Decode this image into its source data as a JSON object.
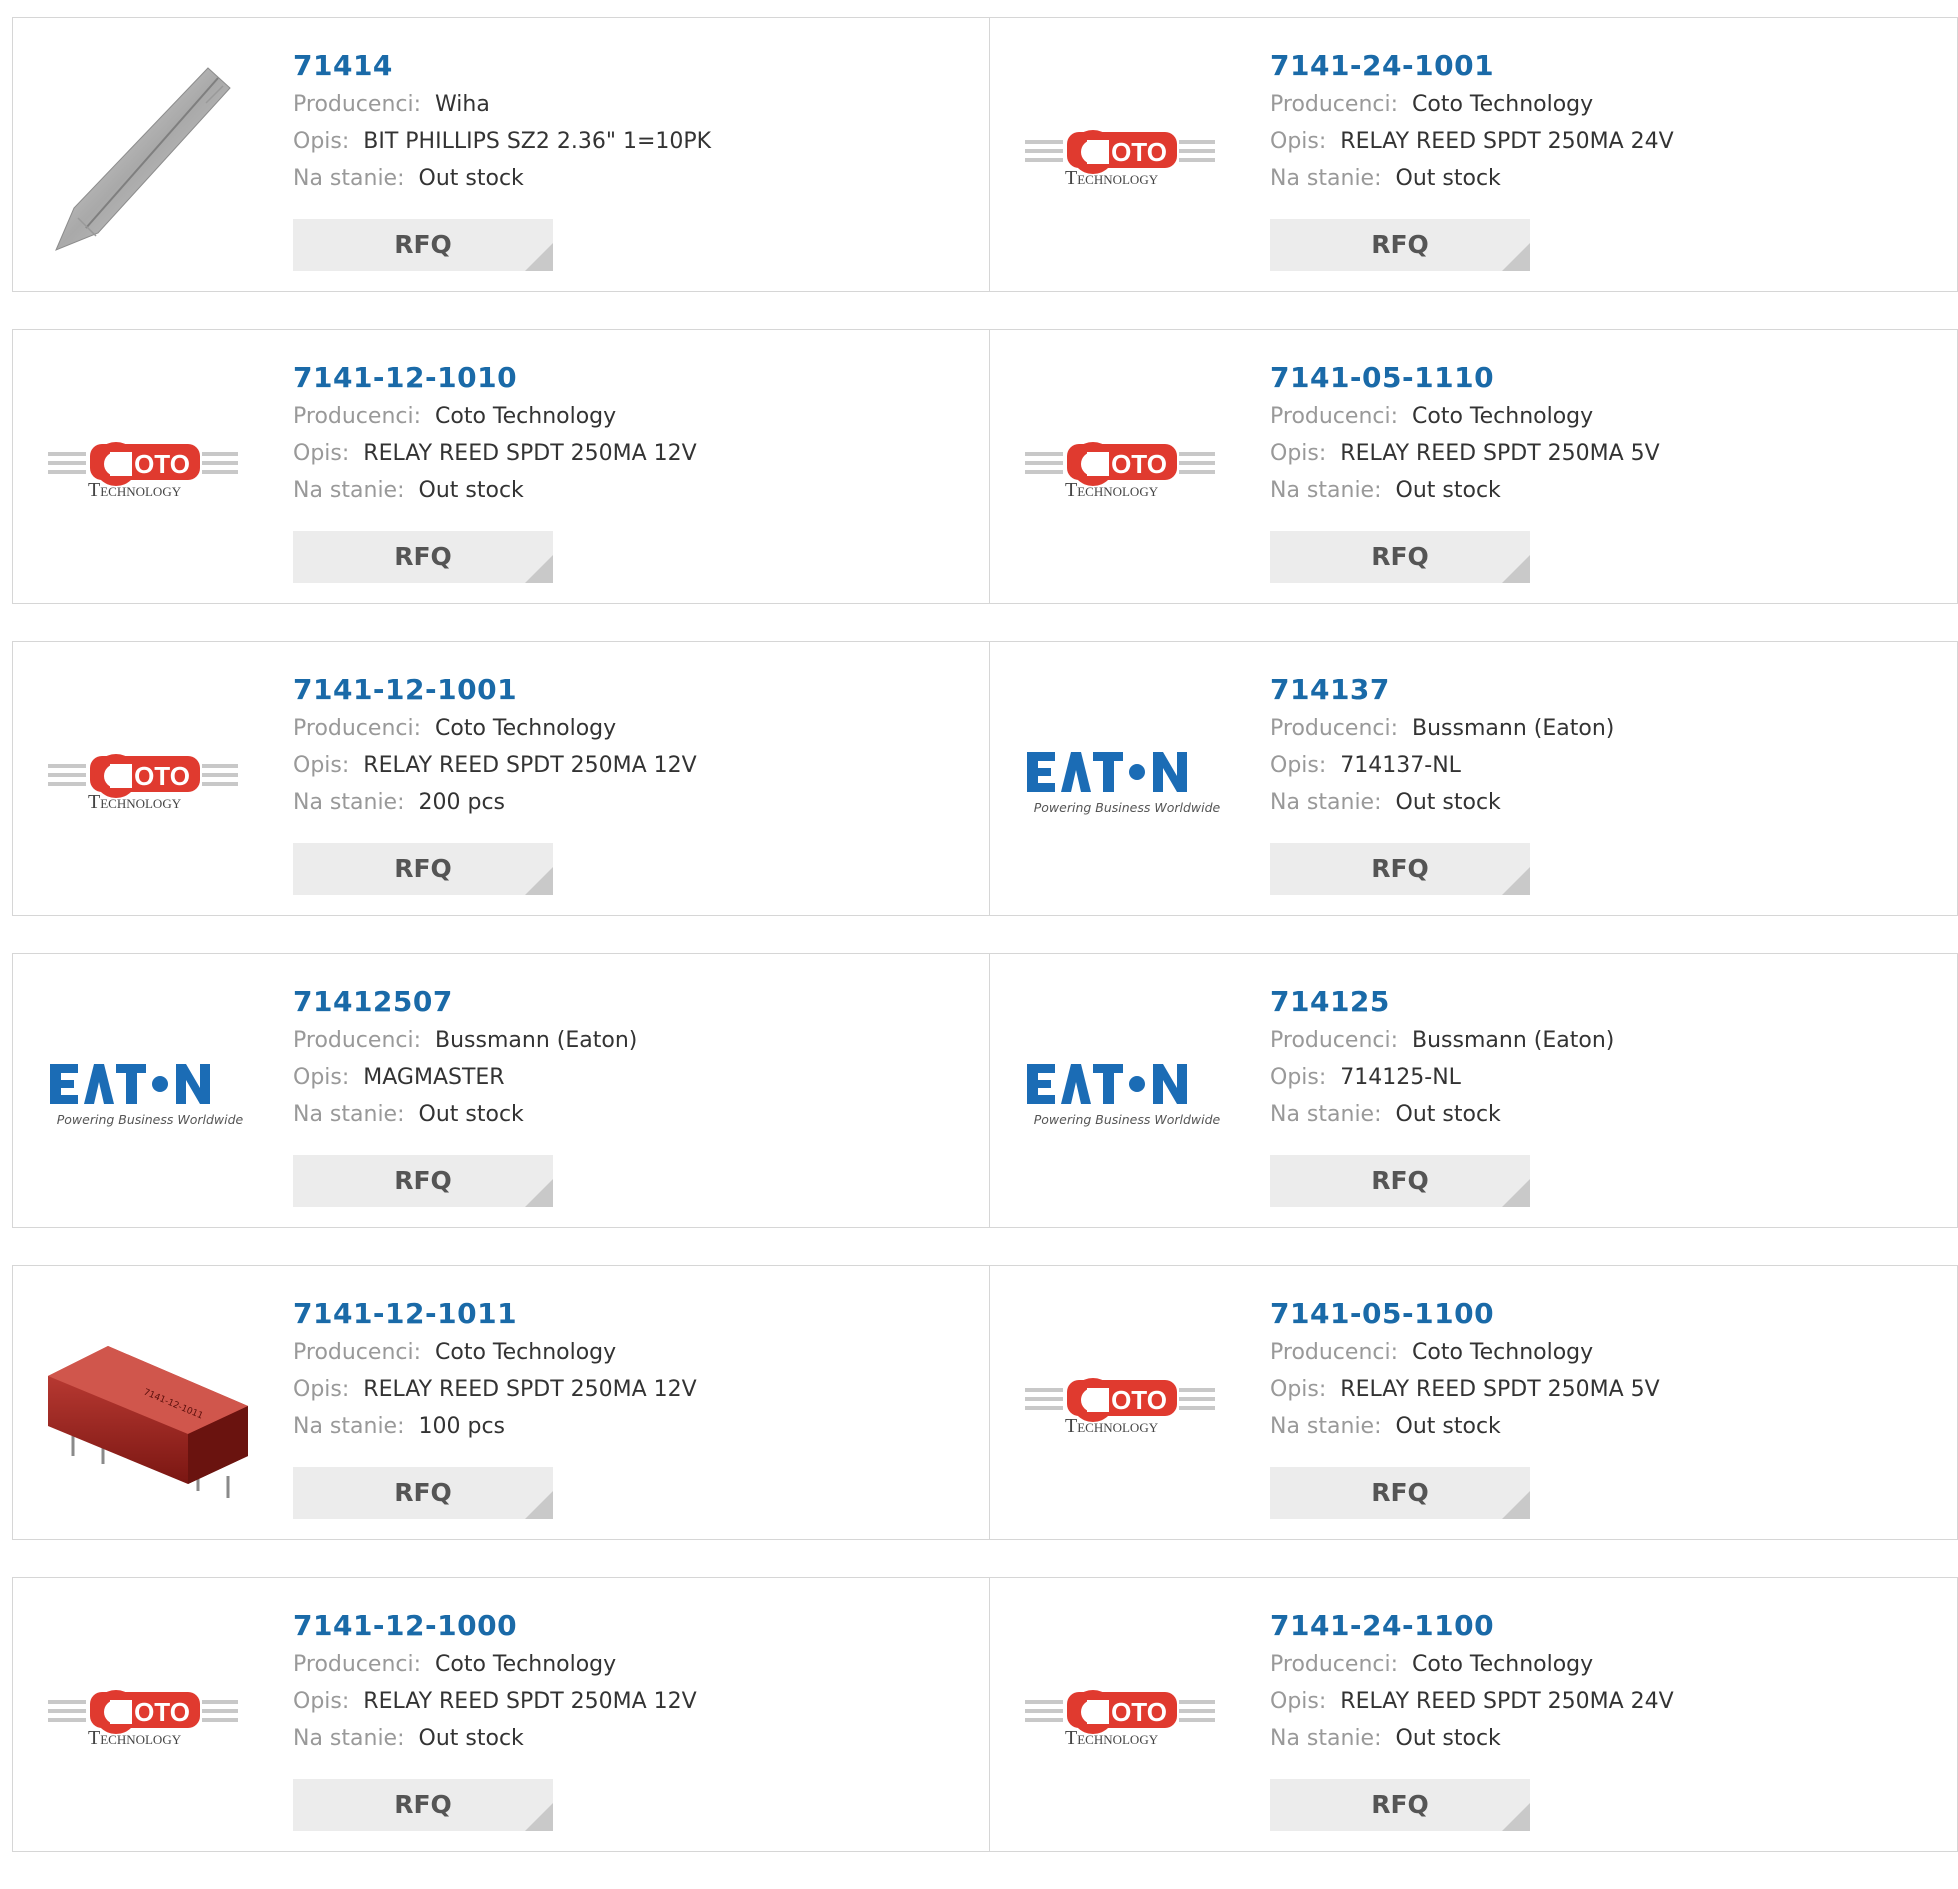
{
  "labels": {
    "manufacturer": "Producenci:",
    "description": "Opis:",
    "stock": "Na stanie:",
    "rfq": "RFQ"
  },
  "coto_logo": {
    "word": "OTO",
    "sub": "ECHNOLOGY",
    "color": "#e03a2f"
  },
  "eaton_logo": {
    "tagline": "Powering Business Worldwide",
    "color": "#1b6cb5"
  },
  "products": [
    {
      "part": "71414",
      "manufacturer": "Wiha",
      "description": "BIT PHILLIPS SZ2 2.36\" 1=10PK",
      "stock": "Out stock",
      "image": "screwdriver-bit"
    },
    {
      "part": "7141-24-1001",
      "manufacturer": "Coto Technology",
      "description": "RELAY REED SPDT 250MA 24V",
      "stock": "Out stock",
      "image": "coto-logo"
    },
    {
      "part": "7141-12-1010",
      "manufacturer": "Coto Technology",
      "description": "RELAY REED SPDT 250MA 12V",
      "stock": "Out stock",
      "image": "coto-logo"
    },
    {
      "part": "7141-05-1110",
      "manufacturer": "Coto Technology",
      "description": "RELAY REED SPDT 250MA 5V",
      "stock": "Out stock",
      "image": "coto-logo"
    },
    {
      "part": "7141-12-1001",
      "manufacturer": "Coto Technology",
      "description": "RELAY REED SPDT 250MA 12V",
      "stock": "200 pcs",
      "image": "coto-logo"
    },
    {
      "part": "714137",
      "manufacturer": "Bussmann (Eaton)",
      "description": "714137-NL",
      "stock": "Out stock",
      "image": "eaton-logo"
    },
    {
      "part": "71412507",
      "manufacturer": "Bussmann (Eaton)",
      "description": "MAGMASTER",
      "stock": "Out stock",
      "image": "eaton-logo"
    },
    {
      "part": "714125",
      "manufacturer": "Bussmann (Eaton)",
      "description": "714125-NL",
      "stock": "Out stock",
      "image": "eaton-logo"
    },
    {
      "part": "7141-12-1011",
      "manufacturer": "Coto Technology",
      "description": "RELAY REED SPDT 250MA 12V",
      "stock": "100 pcs",
      "image": "reed-relay-photo"
    },
    {
      "part": "7141-05-1100",
      "manufacturer": "Coto Technology",
      "description": "RELAY REED SPDT 250MA 5V",
      "stock": "Out stock",
      "image": "coto-logo"
    },
    {
      "part": "7141-12-1000",
      "manufacturer": "Coto Technology",
      "description": "RELAY REED SPDT 250MA 12V",
      "stock": "Out stock",
      "image": "coto-logo"
    },
    {
      "part": "7141-24-1100",
      "manufacturer": "Coto Technology",
      "description": "RELAY REED SPDT 250MA 24V",
      "stock": "Out stock",
      "image": "coto-logo"
    }
  ]
}
